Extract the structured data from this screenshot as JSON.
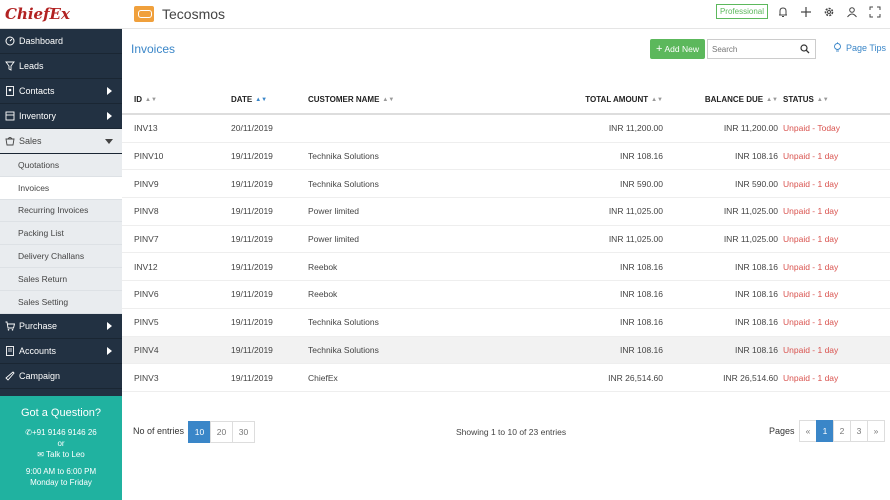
{
  "app": {
    "logo": "ChiefEx",
    "company": "Tecosmos",
    "plan_badge": "Professional"
  },
  "sidebar": {
    "items": [
      {
        "label": "Dashboard",
        "icon": "dashboard-icon"
      },
      {
        "label": "Leads",
        "icon": "filter-icon"
      },
      {
        "label": "Contacts",
        "icon": "contacts-icon"
      },
      {
        "label": "Inventory",
        "icon": "inventory-icon"
      },
      {
        "label": "Sales",
        "icon": "sales-icon"
      }
    ],
    "sales_sub": [
      "Quotations",
      "Invoices",
      "Recurring Invoices",
      "Packing List",
      "Delivery Challans",
      "Sales Return",
      "Sales Setting"
    ],
    "bottom_items": [
      {
        "label": "Purchase",
        "icon": "cart-icon"
      },
      {
        "label": "Accounts",
        "icon": "accounts-icon"
      },
      {
        "label": "Campaign",
        "icon": "campaign-icon"
      }
    ]
  },
  "help": {
    "title": "Got a Question?",
    "phone": "+91 9146 9146 26",
    "or": "or",
    "talk": "Talk to Leo",
    "hours": "9:00 AM to 6:00 PM",
    "days": "Monday to Friday"
  },
  "header": {
    "title": "Invoices",
    "add_label": "Add New",
    "search_placeholder": "Search",
    "tips_label": "Page Tips"
  },
  "table": {
    "columns": [
      "ID",
      "DATE",
      "CUSTOMER NAME",
      "TOTAL AMOUNT",
      "BALANCE DUE",
      "STATUS"
    ],
    "rows": [
      {
        "id": "INV13",
        "date": "20/11/2019",
        "customer": "",
        "total": "INR 11,200.00",
        "balance": "INR 11,200.00",
        "status": "Unpaid - Today"
      },
      {
        "id": "PINV10",
        "date": "19/11/2019",
        "customer": "Technika Solutions",
        "total": "INR 108.16",
        "balance": "INR 108.16",
        "status": "Unpaid - 1 day"
      },
      {
        "id": "PINV9",
        "date": "19/11/2019",
        "customer": "Technika Solutions",
        "total": "INR 590.00",
        "balance": "INR 590.00",
        "status": "Unpaid - 1 day"
      },
      {
        "id": "PINV8",
        "date": "19/11/2019",
        "customer": "Power limited",
        "total": "INR 11,025.00",
        "balance": "INR 11,025.00",
        "status": "Unpaid - 1 day"
      },
      {
        "id": "PINV7",
        "date": "19/11/2019",
        "customer": "Power limited",
        "total": "INR 11,025.00",
        "balance": "INR 11,025.00",
        "status": "Unpaid - 1 day"
      },
      {
        "id": "INV12",
        "date": "19/11/2019",
        "customer": "Reebok",
        "total": "INR 108.16",
        "balance": "INR 108.16",
        "status": "Unpaid - 1 day"
      },
      {
        "id": "PINV6",
        "date": "19/11/2019",
        "customer": "Reebok",
        "total": "INR 108.16",
        "balance": "INR 108.16",
        "status": "Unpaid - 1 day"
      },
      {
        "id": "PINV5",
        "date": "19/11/2019",
        "customer": "Technika Solutions",
        "total": "INR 108.16",
        "balance": "INR 108.16",
        "status": "Unpaid - 1 day"
      },
      {
        "id": "PINV4",
        "date": "19/11/2019",
        "customer": "Technika Solutions",
        "total": "INR 108.16",
        "balance": "INR 108.16",
        "status": "Unpaid - 1 day"
      },
      {
        "id": "PINV3",
        "date": "19/11/2019",
        "customer": "ChiefEx",
        "total": "INR 26,514.60",
        "balance": "INR 26,514.60",
        "status": "Unpaid - 1 day"
      }
    ]
  },
  "footer": {
    "entries_label": "No of entries",
    "sizes": [
      "10",
      "20",
      "30"
    ],
    "showing": "Showing 1 to 10 of 23 entries",
    "pages_label": "Pages",
    "pager": [
      "«",
      "1",
      "2",
      "3",
      "»"
    ]
  }
}
